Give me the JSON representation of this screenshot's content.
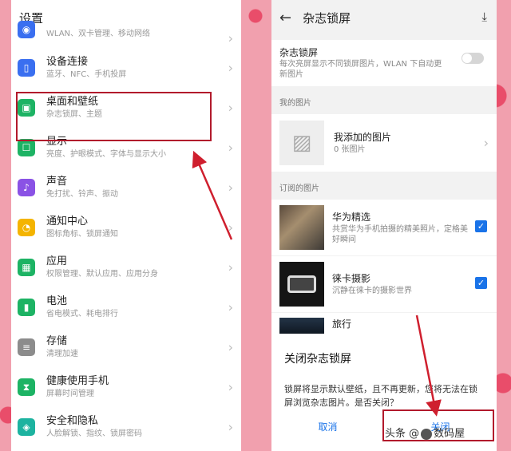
{
  "left": {
    "title": "设置",
    "items": [
      {
        "title": "",
        "sub": "WLAN、双卡管理、移动网络",
        "icon": "wifi-icon",
        "color": "#3a6ff0"
      },
      {
        "title": "设备连接",
        "sub": "蓝牙、NFC、手机投屏",
        "icon": "device-link-icon",
        "color": "#3a6ff0"
      },
      {
        "title": "桌面和壁纸",
        "sub": "杂志锁屏、主题",
        "icon": "wallpaper-icon",
        "color": "#1db364"
      },
      {
        "title": "显示",
        "sub": "亮度、护眼模式、字体与显示大小",
        "icon": "display-icon",
        "color": "#1db364"
      },
      {
        "title": "声音",
        "sub": "免打扰、铃声、振动",
        "icon": "sound-icon",
        "color": "#8a52e5"
      },
      {
        "title": "通知中心",
        "sub": "图标角标、锁屏通知",
        "icon": "bell-icon",
        "color": "#f4b400"
      },
      {
        "title": "应用",
        "sub": "权限管理、默认应用、应用分身",
        "icon": "apps-icon",
        "color": "#1db364"
      },
      {
        "title": "电池",
        "sub": "省电模式、耗电排行",
        "icon": "battery-icon",
        "color": "#1db364"
      },
      {
        "title": "存储",
        "sub": "清理加速",
        "icon": "storage-icon",
        "color": "#8c8c8c"
      },
      {
        "title": "健康使用手机",
        "sub": "屏幕时间管理",
        "icon": "hourglass-icon",
        "color": "#1db364"
      },
      {
        "title": "安全和隐私",
        "sub": "人脸解锁、指纹、锁屏密码",
        "icon": "shield-icon",
        "color": "#1db3a0"
      }
    ]
  },
  "right": {
    "title": "杂志锁屏",
    "toggle": {
      "title": "杂志锁屏",
      "desc": "每次亮屏显示不同锁屏图片，WLAN 下自动更新图片"
    },
    "my_section": "我的图片",
    "my_item": {
      "title": "我添加的图片",
      "sub": "0 张图片"
    },
    "sub_section": "订阅的图片",
    "subs": [
      {
        "title": "华为精选",
        "sub": "共赏华为手机拍摄的精美照片，定格美好瞬间"
      },
      {
        "title": "徕卡摄影",
        "sub": "沉静在徕卡的摄影世界"
      },
      {
        "title": "旅行",
        "sub": ""
      }
    ]
  },
  "dialog": {
    "title": "关闭杂志锁屏",
    "message": "锁屏将显示默认壁纸，且不再更新，您将无法在锁屏浏览杂志图片。是否关闭？",
    "cancel": "取消",
    "confirm": "关闭"
  },
  "watermark": "头条 @",
  "watermark_tail": "数码屋"
}
